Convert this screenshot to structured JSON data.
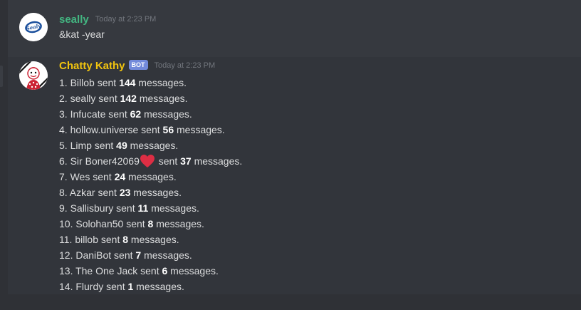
{
  "first_message": {
    "username": "seally",
    "timestamp": "Today at 2:23 PM",
    "text": "&kat -year",
    "avatar_text": "Sealy"
  },
  "second_message": {
    "username": "Chatty Kathy",
    "bot_tag": "BOT",
    "timestamp": "Today at 2:23 PM",
    "lines": [
      {
        "prefix": "1. Billob sent ",
        "count": "144",
        "suffix": " messages."
      },
      {
        "prefix": "2. seally sent ",
        "count": "142",
        "suffix": " messages."
      },
      {
        "prefix": "3. Infucate sent ",
        "count": "62",
        "suffix": " messages."
      },
      {
        "prefix": "4. hollow.universe sent ",
        "count": "56",
        "suffix": " messages."
      },
      {
        "prefix": "5. Limp sent ",
        "count": "49",
        "suffix": " messages."
      },
      {
        "prefix": "6. Sir Boner42069",
        "emoji": "heart",
        "mid": " sent ",
        "count": "37",
        "suffix": " messages."
      },
      {
        "prefix": "7. Wes sent ",
        "count": "24",
        "suffix": " messages."
      },
      {
        "prefix": "8. Azkar sent ",
        "count": "23",
        "suffix": " messages."
      },
      {
        "prefix": "9. Sallisbury sent ",
        "count": "11",
        "suffix": " messages."
      },
      {
        "prefix": "10. Solohan50 sent ",
        "count": "8",
        "suffix": " messages."
      },
      {
        "prefix": "11. billob sent ",
        "count": "8",
        "suffix": " messages."
      },
      {
        "prefix": "12. DaniBot sent ",
        "count": "7",
        "suffix": " messages."
      },
      {
        "prefix": "13. The One Jack sent ",
        "count": "6",
        "suffix": " messages."
      },
      {
        "prefix": "14. Flurdy sent ",
        "count": "1",
        "suffix": " messages."
      }
    ]
  },
  "colors": {
    "background": "#36393f",
    "highlight_background": "#32353b",
    "sealy_name": "#43b581",
    "kathy_name": "#f1c40f",
    "bot_tag": "#7289da",
    "heart": "#dd2e44"
  }
}
